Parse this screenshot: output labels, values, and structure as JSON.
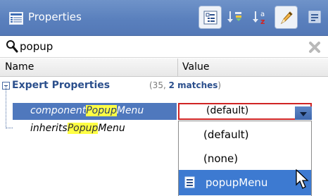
{
  "header": {
    "title": "Properties",
    "toolbar_icons": [
      "categorized-view-icon",
      "sort-by-category-icon",
      "sort-alphabetically-icon",
      "show-expert-properties-icon",
      "description-icon"
    ]
  },
  "search": {
    "value": "popup"
  },
  "columns": {
    "name": "Name",
    "value": "Value"
  },
  "category": {
    "label": "Expert Properties",
    "count_prefix": "(35, ",
    "count_matches": "2 matches",
    "count_suffix": ")"
  },
  "properties": [
    {
      "pre": "component",
      "match": "Popup",
      "post": "Menu"
    },
    {
      "pre": "inherits",
      "match": "Popup",
      "post": "Menu"
    }
  ],
  "value_combo": {
    "selected": "(default)"
  },
  "dropdown": {
    "options": [
      "(default)",
      "(none)",
      "popupMenu"
    ]
  },
  "colors": {
    "header": "#5a80bd",
    "selection": "#4f78bd",
    "highlight": "#ffff44",
    "combo_border": "#d02424",
    "list_selection": "#3d7ad1"
  }
}
